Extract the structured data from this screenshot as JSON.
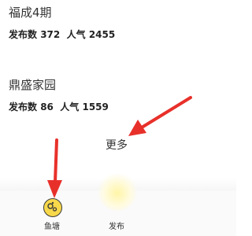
{
  "communities": [
    {
      "name": "福成4期",
      "posts_label": "发布数",
      "posts": "372",
      "popularity_label": "人气",
      "popularity": "2455"
    },
    {
      "name": "鼎盛家园",
      "posts_label": "发布数",
      "posts": "86",
      "popularity_label": "人气",
      "popularity": "1559"
    }
  ],
  "more_label": "更多",
  "tab_bar": {
    "tabs": [
      {
        "label": "鱼塘",
        "icon": "fish-pond-icon"
      },
      {
        "label": "发布",
        "icon": "publish-icon"
      }
    ]
  },
  "colors": {
    "annotation_arrow": "#e8302a",
    "pond_icon": "#f7d84a"
  }
}
